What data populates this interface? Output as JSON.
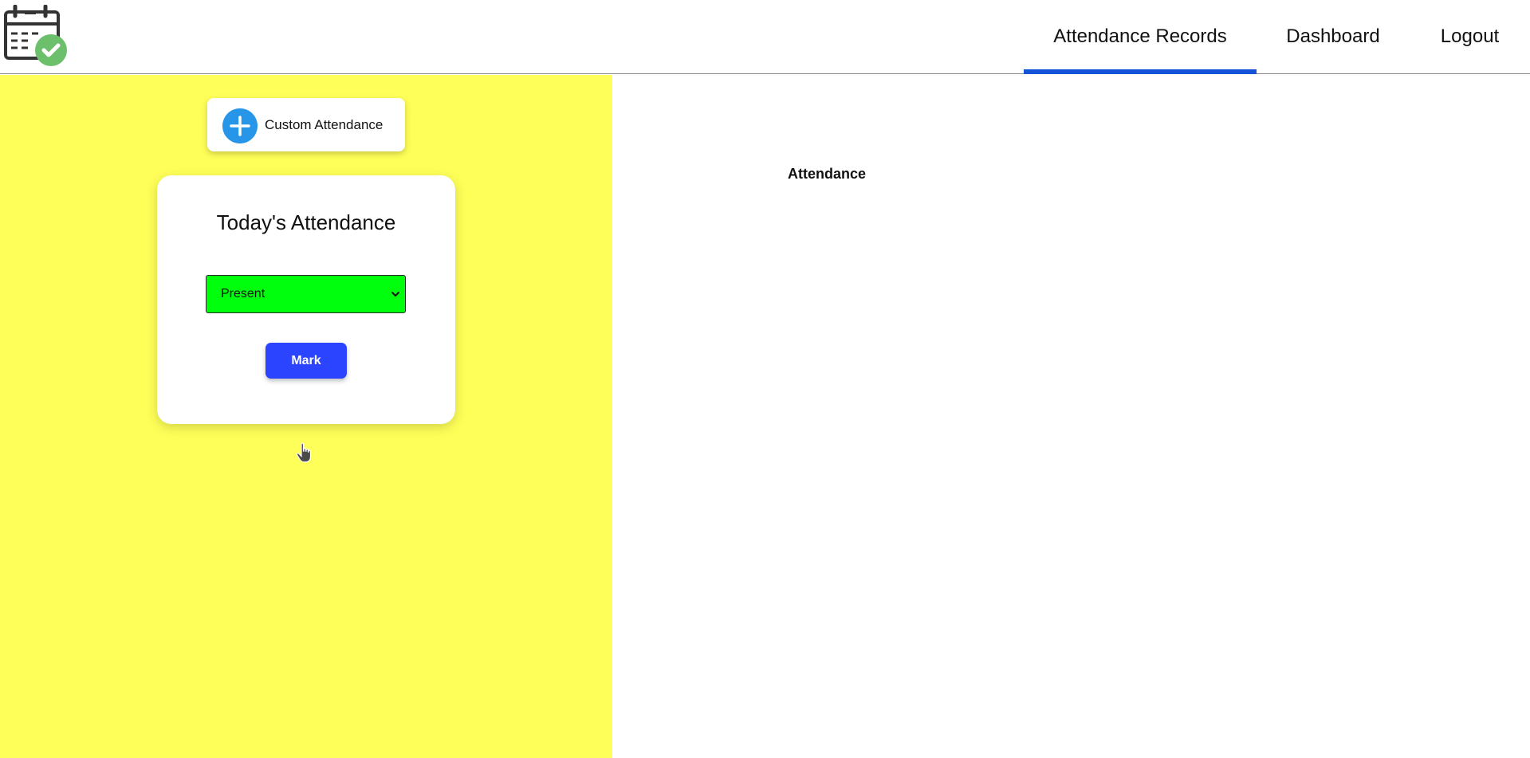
{
  "app": {
    "logo_icon": "calendar-check-icon"
  },
  "nav": {
    "items": [
      {
        "label": "Attendance Records",
        "active": true
      },
      {
        "label": "Dashboard",
        "active": false
      },
      {
        "label": "Logout",
        "active": false
      }
    ],
    "active_color": "#1452d8"
  },
  "left": {
    "background": "#ffff59",
    "custom_button": {
      "label": "Custom Attendance",
      "icon": "plus-circle-icon",
      "icon_color": "#2796e8"
    },
    "card": {
      "title": "Today's Attendance",
      "select": {
        "value": "Present",
        "background": "#00ff0d"
      },
      "mark_button": {
        "label": "Mark",
        "color": "#2b44ff"
      }
    }
  },
  "right": {
    "title": "Attendance"
  }
}
